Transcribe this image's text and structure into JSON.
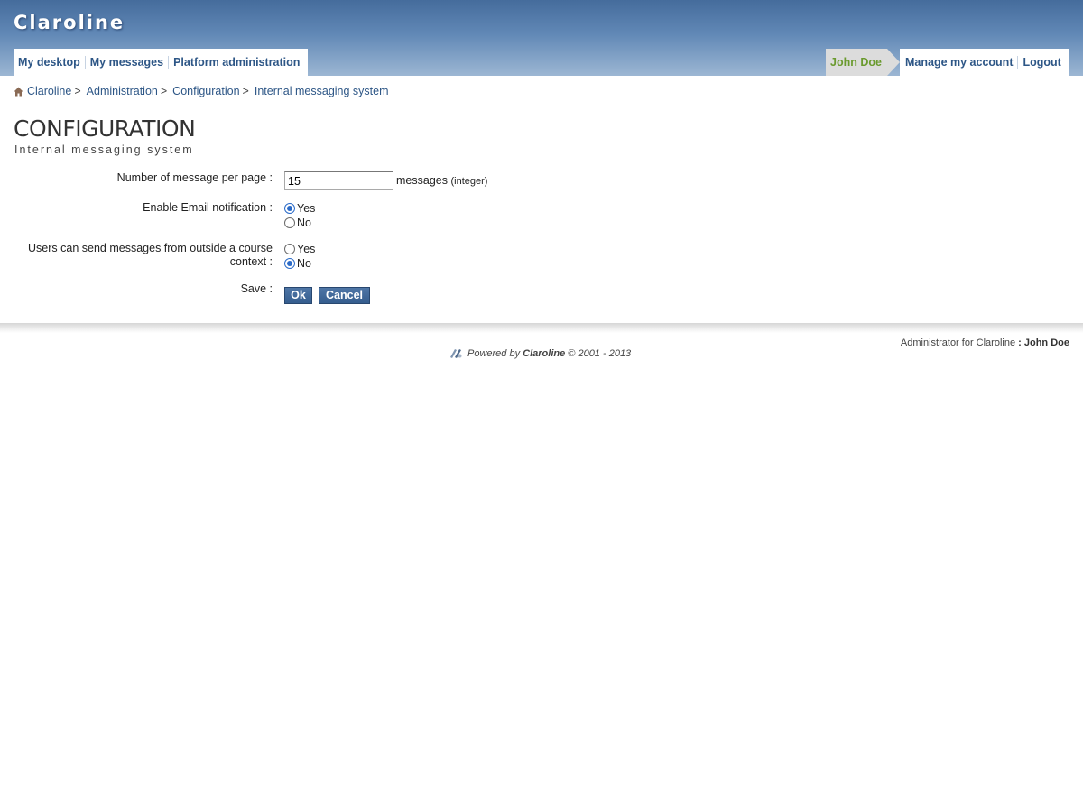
{
  "site": {
    "name": "Claroline"
  },
  "nav_left": [
    {
      "label": "My desktop"
    },
    {
      "label": "My messages"
    },
    {
      "label": "Platform administration"
    }
  ],
  "user": {
    "name": "John Doe"
  },
  "nav_right": [
    {
      "label": "Manage my account"
    },
    {
      "label": "Logout"
    }
  ],
  "breadcrumb": [
    {
      "label": "Claroline",
      "sep": ">"
    },
    {
      "label": "Administration",
      "sep": ">"
    },
    {
      "label": "Configuration",
      "sep": ">"
    },
    {
      "label": "Internal messaging system"
    }
  ],
  "page": {
    "title": "CONFIGURATION",
    "subtitle": "Internal messaging system"
  },
  "form": {
    "per_page": {
      "label": "Number of message per page :",
      "value": "15",
      "suffix": "messages",
      "hint": "(integer)"
    },
    "email_notification": {
      "label": "Enable Email notification :",
      "options": [
        {
          "label": "Yes",
          "checked": true
        },
        {
          "label": "No",
          "checked": false
        }
      ]
    },
    "outside_course": {
      "label_line1": "Users can send messages from outside a course",
      "label_line2": "context :",
      "options": [
        {
          "label": "Yes",
          "checked": false
        },
        {
          "label": "No",
          "checked": true
        }
      ]
    },
    "save": {
      "label": "Save :",
      "ok_label": "Ok",
      "cancel_label": "Cancel"
    }
  },
  "footer": {
    "admin_prefix": "Administrator for Claroline",
    "admin_sep": ":",
    "admin_name": "John Doe",
    "powered_prefix": "Powered by",
    "powered_brand": "Claroline",
    "powered_suffix": "© 2001 - 2013"
  },
  "colors": {
    "banner": "#456c9c",
    "link": "#2d5686",
    "user": "#6a9a2e",
    "button": "#355d8e"
  },
  "icons": {
    "home": "home-icon",
    "powered": "claroline-logo-icon"
  }
}
